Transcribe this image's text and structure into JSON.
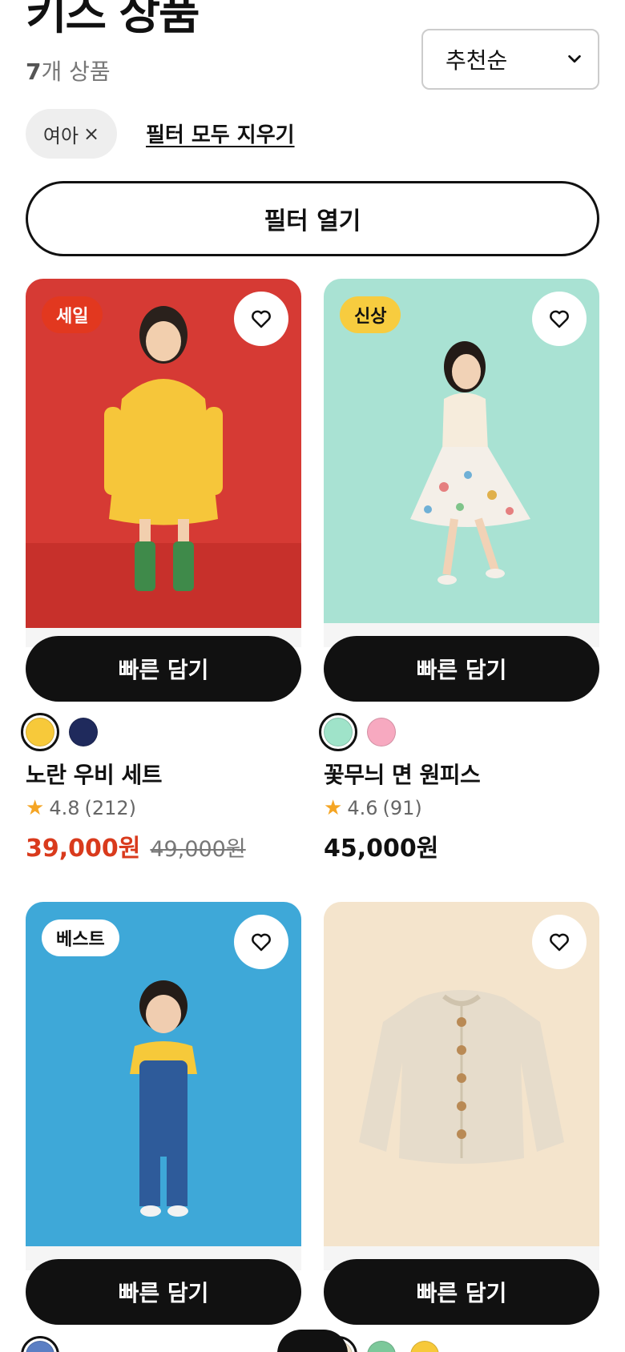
{
  "header": {
    "title": "키즈 상품",
    "count_number": "7",
    "count_suffix": "개 상품"
  },
  "sort": {
    "selected": "추천순",
    "icon": "chevron-down-icon"
  },
  "active_filters": [
    {
      "label": "여아",
      "remove_symbol": "×"
    }
  ],
  "clear_filters_label": "필터 모두 지우기",
  "open_filter_label": "필터 열기",
  "colors": {
    "sale_badge": "#e2381f",
    "new_badge": "#f7cc3f",
    "best_badge": "#ffffff",
    "sale_price": "#d93a1c",
    "star": "#f5a524"
  },
  "products": [
    {
      "badge": "세일",
      "quick_add": "빠른 담기",
      "swatches": [
        {
          "color": "#f7c93a",
          "selected": true
        },
        {
          "color": "#1f2a5c",
          "selected": false
        }
      ],
      "name": "노란 우비 세트",
      "rating": "4.8",
      "reviews": "(212)",
      "price": "39,000원",
      "original_price": "49,000원"
    },
    {
      "badge": "신상",
      "quick_add": "빠른 담기",
      "swatches": [
        {
          "color": "#9fe3c9",
          "selected": true
        },
        {
          "color": "#f7a9c0",
          "selected": false
        }
      ],
      "name": "꽃무늬 면 원피스",
      "rating": "4.6",
      "reviews": "(91)",
      "price": "45,000원",
      "original_price": ""
    },
    {
      "badge": "베스트",
      "quick_add": "빠른 담기",
      "swatches": [
        {
          "color": "#5b7fc4",
          "selected": true
        }
      ],
      "name": "",
      "rating": "",
      "reviews": "",
      "price": "",
      "original_price": ""
    },
    {
      "badge": "",
      "quick_add": "빠른 담기",
      "swatches": [
        {
          "color": "#f0e2c8",
          "selected": true
        },
        {
          "color": "#7cc89a",
          "selected": false
        },
        {
          "color": "#f7c93a",
          "selected": false
        }
      ],
      "name": "",
      "rating": "",
      "reviews": "",
      "price": "",
      "original_price": ""
    }
  ]
}
